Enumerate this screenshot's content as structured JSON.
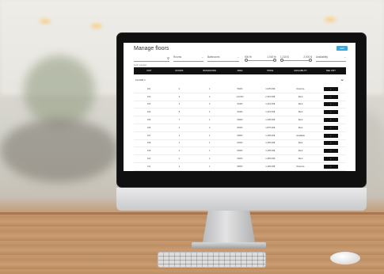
{
  "app": {
    "title": "Manage floors",
    "add_label": "Add"
  },
  "filters": {
    "search_placeholder": "Unit number",
    "rooms_label": "Rooms",
    "bathrooms_label": "Bathrooms",
    "area_min": "500 ft²",
    "area_max": "1,000 ft²",
    "price_min": "1,215 $",
    "price_max": "2,000 $",
    "availability_label": "Availability"
  },
  "table": {
    "columns": [
      "UNIT",
      "ROOMS",
      "BATHROOMS",
      "AREA",
      "PRICE",
      "AVAILABILITY",
      "SEE UNIT"
    ],
    "group_label": "FLOOR 1",
    "rows": [
      {
        "unit": "101",
        "rooms": "2",
        "baths": "1",
        "area": "564ft²",
        "price": "1,035.00$",
        "availability": "Reserve",
        "action": "›"
      },
      {
        "unit": "102",
        "rooms": "3",
        "baths": "2",
        "area": "1,021ft²",
        "price": "2,315.00$",
        "availability": "Rent",
        "action": "›"
      },
      {
        "unit": "103",
        "rooms": "4",
        "baths": "2",
        "area": "524ft²",
        "price": "1,215.00$",
        "availability": "Rent",
        "action": "›"
      },
      {
        "unit": "104",
        "rooms": "8",
        "baths": "1",
        "area": "524ft²",
        "price": "1,215.00$",
        "availability": "Rent",
        "action": "›"
      },
      {
        "unit": "105",
        "rooms": "7",
        "baths": "1",
        "area": "684ft²",
        "price": "1,405.00$",
        "availability": "Rent",
        "action": "›"
      },
      {
        "unit": "106",
        "rooms": "2",
        "baths": "2",
        "area": "804ft²",
        "price": "1,875.00$",
        "availability": "Rent",
        "action": "›"
      },
      {
        "unit": "107",
        "rooms": "1",
        "baths": "1",
        "area": "684ft²",
        "price": "1,405.00$",
        "availability": "Available",
        "action": "›"
      },
      {
        "unit": "108",
        "rooms": "1",
        "baths": "1",
        "area": "602ft²",
        "price": "1,465.00$",
        "availability": "Rent",
        "action": "›"
      },
      {
        "unit": "109",
        "rooms": "1",
        "baths": "1",
        "area": "694ft²",
        "price": "1,405.00$",
        "availability": "Rent",
        "action": "›"
      },
      {
        "unit": "110",
        "rooms": "1",
        "baths": "1",
        "area": "602ft²",
        "price": "1,465.00$",
        "availability": "Rent",
        "action": "›"
      },
      {
        "unit": "111",
        "rooms": "1",
        "baths": "1",
        "area": "565ft²",
        "price": "1,465.00$",
        "availability": "Reserve",
        "action": "›"
      }
    ]
  },
  "colors": {
    "accent": "#3aa7e0",
    "header_bg": "#111111"
  }
}
